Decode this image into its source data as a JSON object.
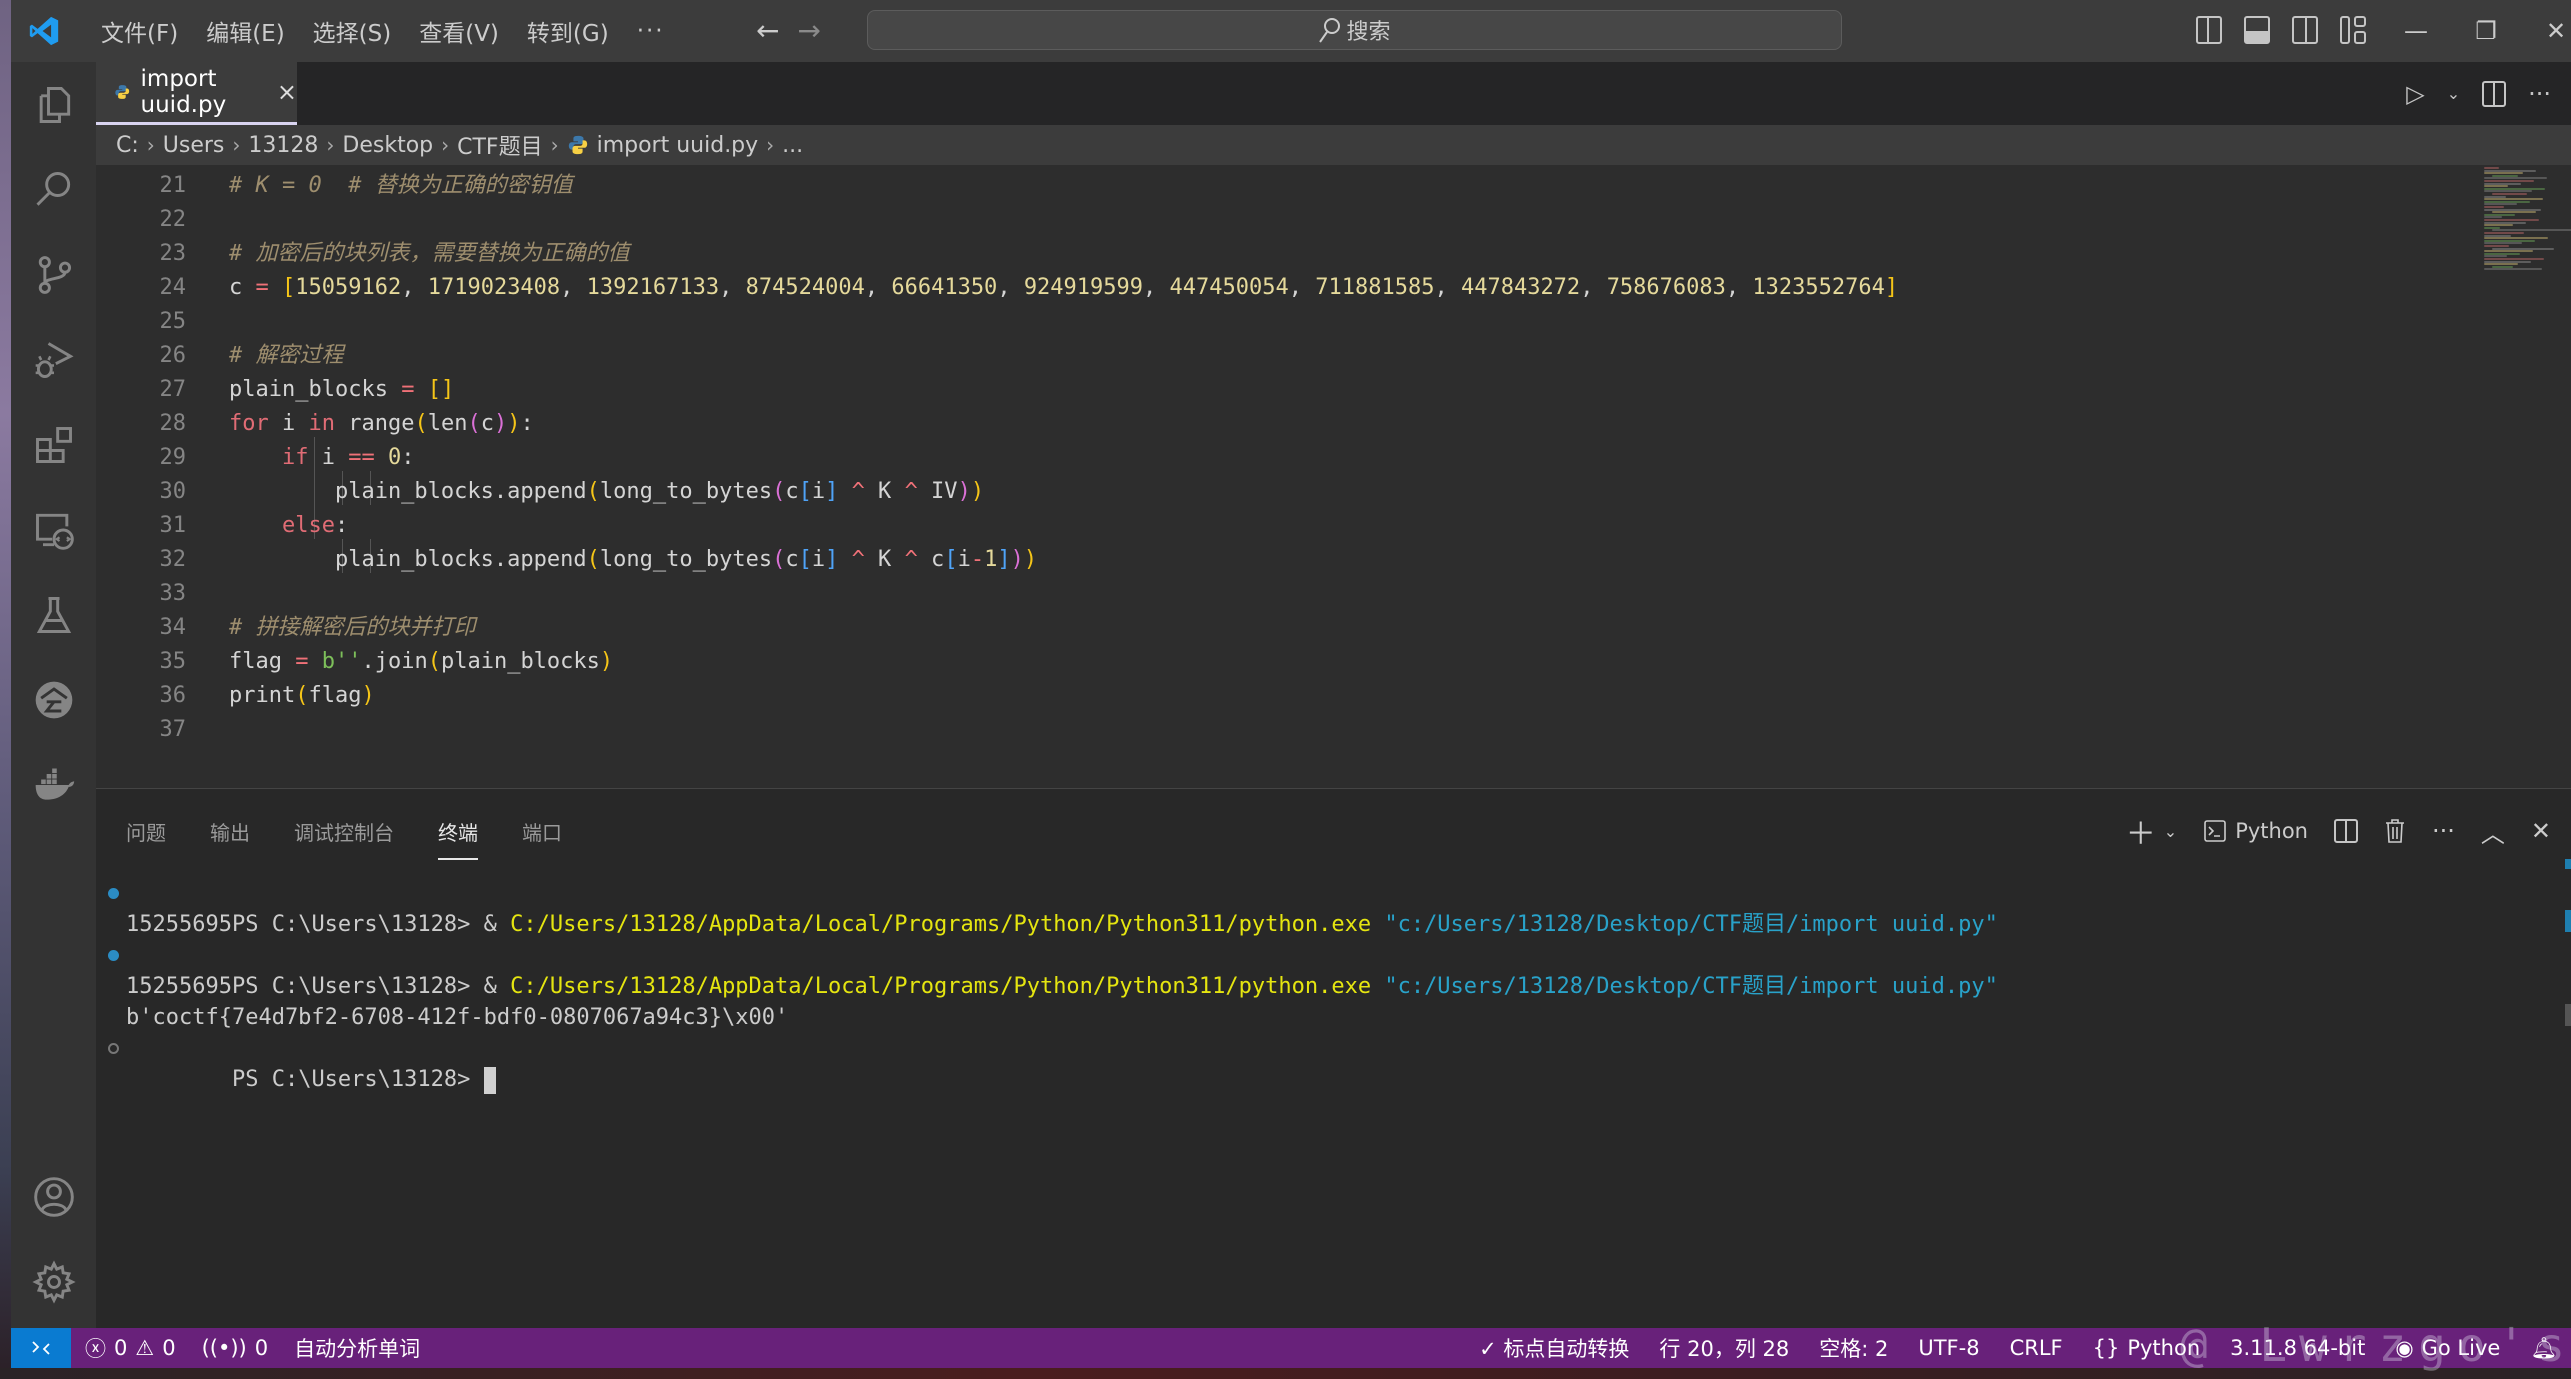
{
  "titlebar": {
    "menu": [
      "文件(F)",
      "编辑(E)",
      "选择(S)",
      "查看(V)",
      "转到(G)",
      "···"
    ],
    "search_placeholder": "搜索",
    "icons": [
      "toggle-primary-sidebar-icon",
      "toggle-panel-icon",
      "toggle-secondary-sidebar-icon",
      "customize-layout-icon"
    ],
    "window_controls": [
      "minimize-icon",
      "restore-icon",
      "close-icon"
    ]
  },
  "activity_bar": {
    "top": [
      "explorer-icon",
      "search-icon",
      "source-control-icon",
      "run-debug-icon",
      "extensions-icon",
      "remote-explorer-icon",
      "testing-icon",
      "extension-custom-icon",
      "docker-icon"
    ],
    "bottom": [
      "accounts-icon",
      "manage-gear-icon"
    ]
  },
  "editor": {
    "tab": {
      "label": "import uuid.py",
      "close": "×"
    },
    "breadcrumb": [
      "C:",
      "Users",
      "13128",
      "Desktop",
      "CTF题目",
      "import uuid.py",
      "..."
    ],
    "lines": [
      {
        "n": "21",
        "text": "# K = 0  # 替换为正确的密钥值"
      },
      {
        "n": "22",
        "text": ""
      },
      {
        "n": "23",
        "text": "# 加密后的块列表，需要替换为正确的值"
      },
      {
        "n": "24",
        "text": "c = [15059162, 1719023408, 1392167133, 874524004, 66641350, 924919599, 447450054, 711881585, 447843272, 758676083, 1323552764]"
      },
      {
        "n": "25",
        "text": ""
      },
      {
        "n": "26",
        "text": "# 解密过程"
      },
      {
        "n": "27",
        "text": "plain_blocks = []"
      },
      {
        "n": "28",
        "text": "for i in range(len(c)):"
      },
      {
        "n": "29",
        "text": "    if i == 0:"
      },
      {
        "n": "30",
        "text": "        plain_blocks.append(long_to_bytes(c[i] ^ K ^ IV))"
      },
      {
        "n": "31",
        "text": "    else:"
      },
      {
        "n": "32",
        "text": "        plain_blocks.append(long_to_bytes(c[i] ^ K ^ c[i-1]))"
      },
      {
        "n": "33",
        "text": ""
      },
      {
        "n": "34",
        "text": "# 拼接解密后的块并打印"
      },
      {
        "n": "35",
        "text": "flag = b''.join(plain_blocks)"
      },
      {
        "n": "36",
        "text": "print(flag)"
      },
      {
        "n": "37",
        "text": ""
      }
    ],
    "c_values": [
      "15059162",
      "1719023408",
      "1392167133",
      "874524004",
      "66641350",
      "924919599",
      "447450054",
      "711881585",
      "447843272",
      "758676083",
      "1323552764"
    ]
  },
  "panel": {
    "tabs": [
      "问题",
      "输出",
      "调试控制台",
      "终端",
      "端口"
    ],
    "active_tab": "终端",
    "terminal_profile": "Python",
    "terminal": {
      "prompt": "PS C:\\Users\\13128> ",
      "amp": "& ",
      "exe": "C:/Users/13128/AppData/Local/Programs/Python/Python311/python.exe",
      "script": "\"c:/Users/13128/Desktop/CTF题目/import uuid.py\"",
      "output1": "15255695",
      "output2": "15255695",
      "flag_output": "b'coctf{7e4d7bf2-6708-412f-bdf0-0807067a94c3}\\x00'"
    }
  },
  "statusbar": {
    "errors": "0",
    "warnings": "0",
    "ports": "0",
    "auto_analyze": "自动分析单词",
    "punct": "✓ 标点自动转换",
    "cursor_pos": "行 20，列 28",
    "indent": "空格: 2",
    "encoding": "UTF-8",
    "eol": "CRLF",
    "language": "Python",
    "interpreter": "3.11.8 64-bit",
    "go_live": "Go Live"
  },
  "watermark": "@ Lwrzgo's blog",
  "colors": {
    "statusbar": "#68217a",
    "remote": "#0a7bd1",
    "titlebar": "#3c3c3c",
    "editor_bg": "#2d2d2d"
  }
}
